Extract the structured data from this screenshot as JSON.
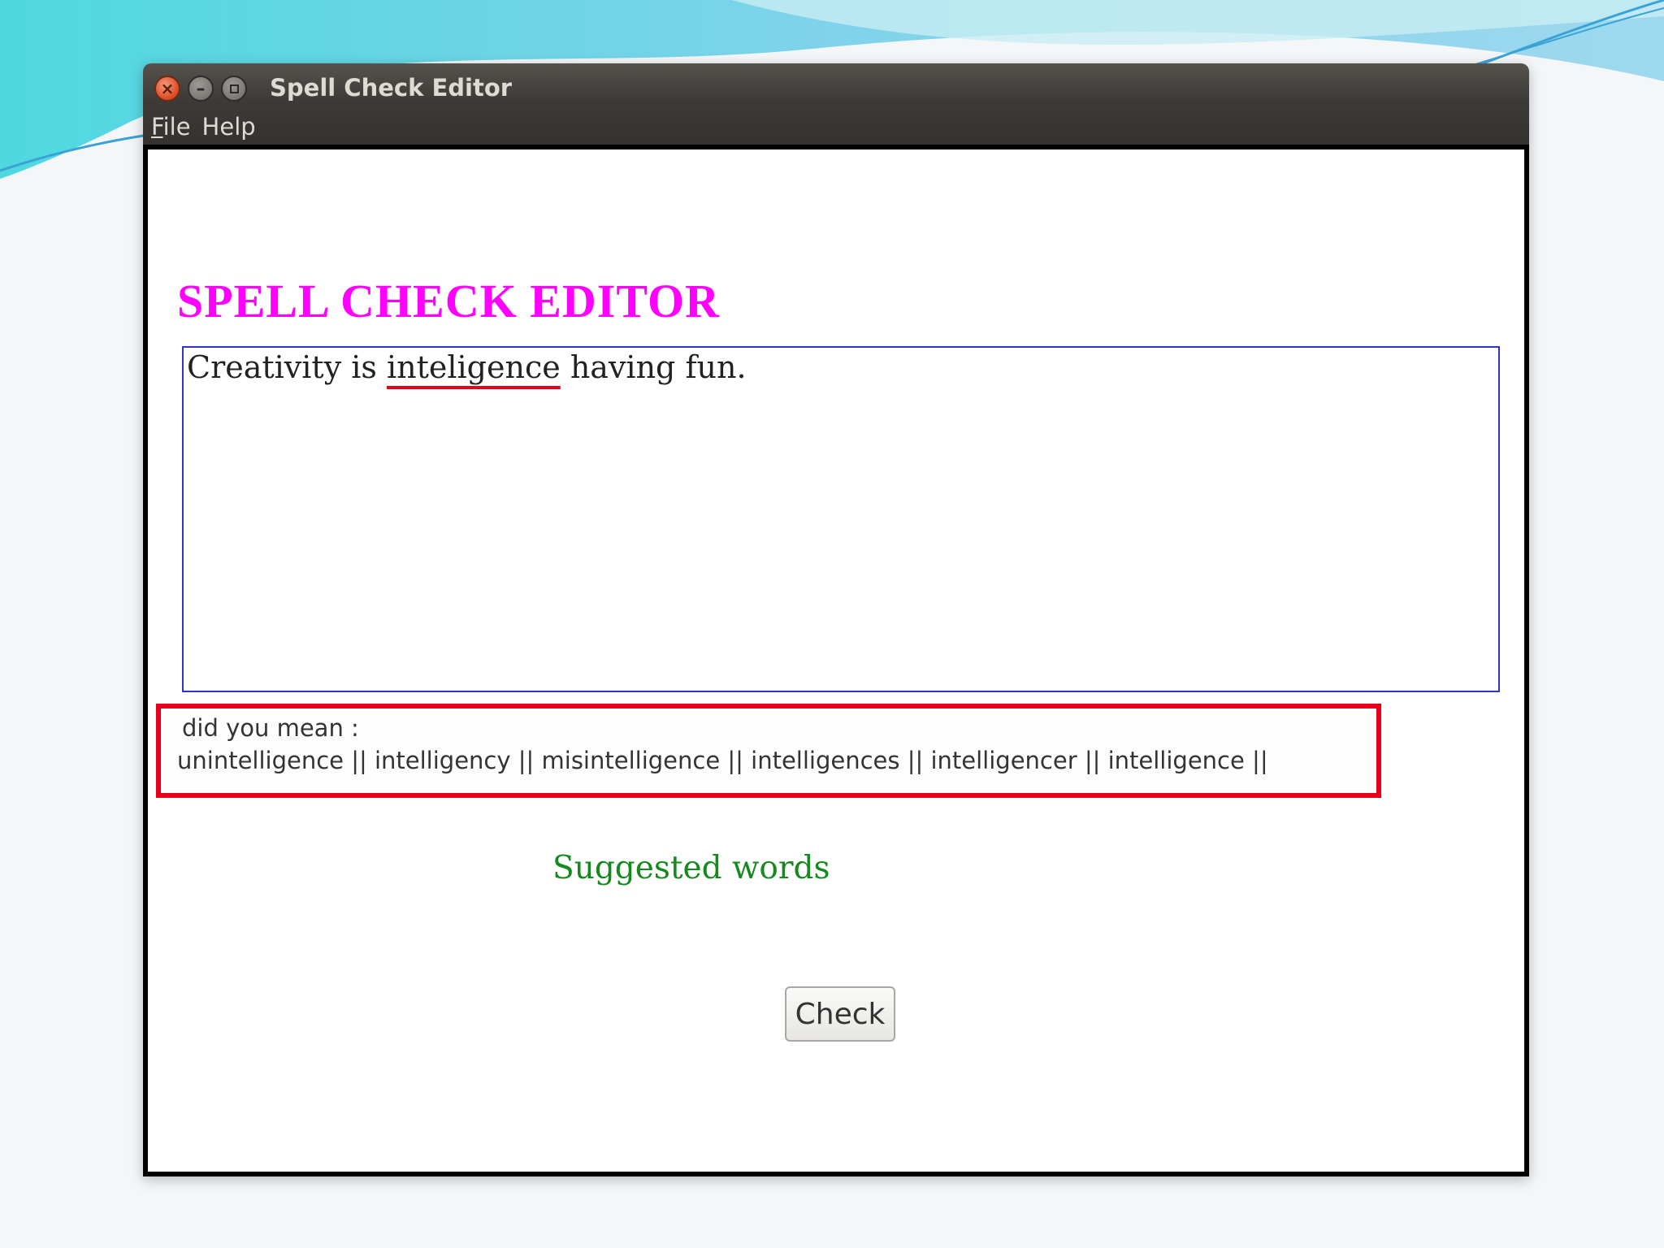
{
  "window": {
    "title": "Spell Check Editor",
    "controls": {
      "close_glyph": "×",
      "minimize_glyph": "–"
    }
  },
  "menu": {
    "file": {
      "mnemonic": "F",
      "rest": "ile"
    },
    "help": {
      "label": "Help"
    }
  },
  "app": {
    "title": "SPELL CHECK EDITOR",
    "editor": {
      "before": "Creativity is ",
      "misspelled": "inteligence",
      "after": " having fun."
    },
    "suggestion_box": {
      "prompt": "did you  mean :",
      "suggestions_text": "unintelligence || intelligency || misintelligence || intelligences || intelligencer || intelligence ||"
    },
    "caption": "Suggested words",
    "check_button": "Check"
  },
  "colors": {
    "title_magenta": "#ff00ff",
    "caption_green": "#148a1e",
    "highlight_red": "#e8001a",
    "editor_border_blue": "#3333cc"
  },
  "icons": [
    "close-icon",
    "minimize-icon",
    "maximize-icon"
  ]
}
